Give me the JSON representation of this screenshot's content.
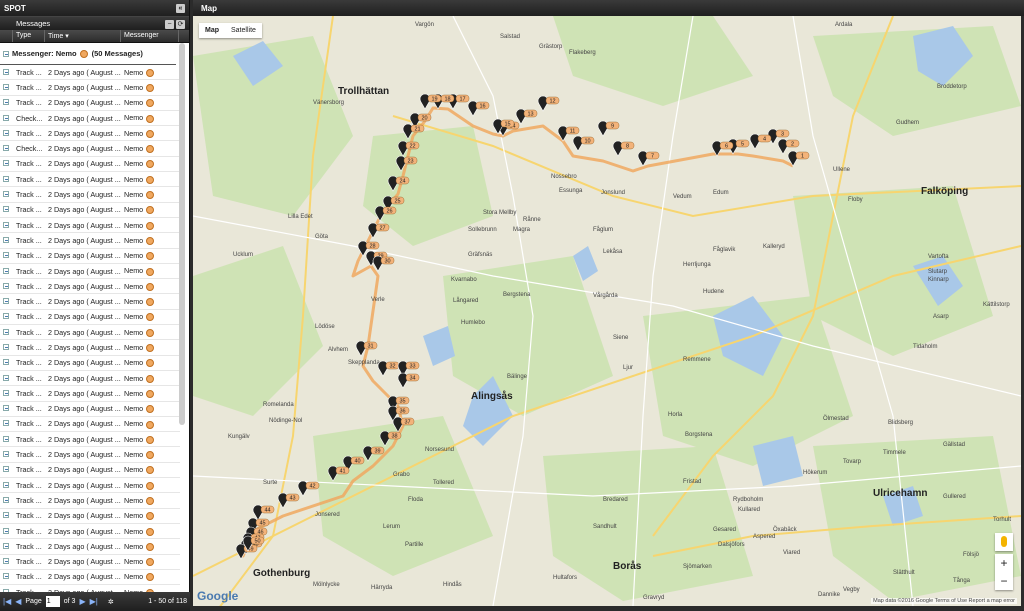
{
  "left_panel": {
    "app_title": "SPOT",
    "messages_title": "Messages",
    "columns": [
      "Type",
      "Time",
      "Messenger"
    ],
    "group_label": "Messenger: Nemo",
    "group_count": "(50 Messages)",
    "rows": [
      {
        "type": "Track ...",
        "time": "2 Days ago ( August ...",
        "messenger": "Nemo"
      },
      {
        "type": "Track ...",
        "time": "2 Days ago ( August ...",
        "messenger": "Nemo"
      },
      {
        "type": "Track ...",
        "time": "2 Days ago ( August ...",
        "messenger": "Nemo"
      },
      {
        "type": "Check...",
        "time": "2 Days ago ( August ...",
        "messenger": "Nemo"
      },
      {
        "type": "Track ...",
        "time": "2 Days ago ( August ...",
        "messenger": "Nemo"
      },
      {
        "type": "Check...",
        "time": "2 Days ago ( August ...",
        "messenger": "Nemo"
      },
      {
        "type": "Track ...",
        "time": "2 Days ago ( August ...",
        "messenger": "Nemo"
      },
      {
        "type": "Track ...",
        "time": "2 Days ago ( August ...",
        "messenger": "Nemo"
      },
      {
        "type": "Track ...",
        "time": "2 Days ago ( August ...",
        "messenger": "Nemo"
      },
      {
        "type": "Track ...",
        "time": "2 Days ago ( August ...",
        "messenger": "Nemo"
      },
      {
        "type": "Track ...",
        "time": "2 Days ago ( August ...",
        "messenger": "Nemo"
      },
      {
        "type": "Track ...",
        "time": "2 Days ago ( August ...",
        "messenger": "Nemo"
      },
      {
        "type": "Track ...",
        "time": "2 Days ago ( August ...",
        "messenger": "Nemo"
      },
      {
        "type": "Track ...",
        "time": "2 Days ago ( August ...",
        "messenger": "Nemo"
      },
      {
        "type": "Track ...",
        "time": "2 Days ago ( August ...",
        "messenger": "Nemo"
      },
      {
        "type": "Track ...",
        "time": "2 Days ago ( August ...",
        "messenger": "Nemo"
      },
      {
        "type": "Track ...",
        "time": "2 Days ago ( August ...",
        "messenger": "Nemo"
      },
      {
        "type": "Track ...",
        "time": "2 Days ago ( August ...",
        "messenger": "Nemo"
      },
      {
        "type": "Track ...",
        "time": "2 Days ago ( August ...",
        "messenger": "Nemo"
      },
      {
        "type": "Track ...",
        "time": "2 Days ago ( August ...",
        "messenger": "Nemo"
      },
      {
        "type": "Track ...",
        "time": "2 Days ago ( August ...",
        "messenger": "Nemo"
      },
      {
        "type": "Track ...",
        "time": "2 Days ago ( August ...",
        "messenger": "Nemo"
      },
      {
        "type": "Track ...",
        "time": "2 Days ago ( August ...",
        "messenger": "Nemo"
      },
      {
        "type": "Track ...",
        "time": "2 Days ago ( August ...",
        "messenger": "Nemo"
      },
      {
        "type": "Track ...",
        "time": "2 Days ago ( August ...",
        "messenger": "Nemo"
      },
      {
        "type": "Track ...",
        "time": "2 Days ago ( August ...",
        "messenger": "Nemo"
      },
      {
        "type": "Track ...",
        "time": "2 Days ago ( August ...",
        "messenger": "Nemo"
      },
      {
        "type": "Track ...",
        "time": "2 Days ago ( August ...",
        "messenger": "Nemo"
      },
      {
        "type": "Track ...",
        "time": "2 Days ago ( August ...",
        "messenger": "Nemo"
      },
      {
        "type": "Track ...",
        "time": "2 Days ago ( August ...",
        "messenger": "Nemo"
      },
      {
        "type": "Track ...",
        "time": "2 Days ago ( August ...",
        "messenger": "Nemo"
      },
      {
        "type": "Track ...",
        "time": "2 Days ago ( August ...",
        "messenger": "Nemo"
      },
      {
        "type": "Track ...",
        "time": "2 Days ago ( August ...",
        "messenger": "Nemo"
      },
      {
        "type": "Track ...",
        "time": "2 Days ago ( August ...",
        "messenger": "Nemo"
      },
      {
        "type": "Track ...",
        "time": "2 Days ago ( August ...",
        "messenger": "Nemo"
      }
    ],
    "footer": {
      "page_label": "Page",
      "page_value": "1",
      "of_label": "of 3",
      "range_label": "1 - 50 of 118"
    }
  },
  "map_panel": {
    "title": "Map",
    "map_types": [
      "Map",
      "Satellite"
    ],
    "attribution": "Map data ©2016 Google   Terms of Use   Report a map error",
    "logo": "Google",
    "towns": [
      "Vargön",
      "Trollhättan",
      "Vänersborg",
      "Grästorp",
      "Flakeberg",
      "Salstad",
      "Ardala",
      "Broddetorp",
      "Gudhem",
      "Falköping",
      "Nossebro",
      "Essunga",
      "Jonslund",
      "Vedum",
      "Edum",
      "Ullene",
      "Floby",
      "Sollebrunn",
      "Stora Mellby",
      "Magra",
      "Fåglum",
      "Lekåsa",
      "Rånne",
      "Herrljunga",
      "Hudene",
      "Fåglavik",
      "Kalleryd",
      "Vårgårda",
      "Bergstena",
      "Långared",
      "Kvarnabo",
      "Gräfsnäs",
      "Lilla Edet",
      "Göta",
      "Ucklum",
      "Lödöse",
      "Alvhem",
      "Skepplanda",
      "Verle",
      "Humlebo",
      "Siene",
      "Ljur",
      "Remmene",
      "Horla",
      "Alingsås",
      "Bälinge",
      "Norsesund",
      "Tollered",
      "Grabo",
      "Floda",
      "Lerum",
      "Partille",
      "Gothenburg",
      "Mölnlycke",
      "Härryda",
      "Hindås",
      "Borås",
      "Hultafors",
      "Sandhult",
      "Bredared",
      "Fristad",
      "Gesared",
      "Öxabäck",
      "Ulricehamn",
      "Gällstad",
      "Gullered",
      "Tovarp",
      "Timmele",
      "Hökerum",
      "Blidsberg",
      "Borgstena",
      "Ölmestad",
      "Vartofta",
      "Slutarp",
      "Kinnarp",
      "Asarp",
      "Tidaholm",
      "Kättilstorp",
      "Torhult",
      "Vegby",
      "Kungälv",
      "Romelanda",
      "Nödinge-Nol",
      "Surte",
      "Jonsered",
      "Kullared",
      "Bollebygd",
      "Aspered",
      "Dalsjöfors",
      "Rydboholm",
      "Sjömarken",
      "Viared",
      "Dannike",
      "Fölsjö",
      "Slätthult",
      "Tånga",
      "Gravryd"
    ],
    "markers": [
      "1",
      "2",
      "3",
      "4",
      "5",
      "6",
      "7",
      "8",
      "9",
      "10",
      "11",
      "12",
      "13",
      "14",
      "15",
      "16",
      "17",
      "18",
      "19",
      "20",
      "21",
      "22",
      "23",
      "24",
      "25",
      "26",
      "27",
      "28",
      "29",
      "30",
      "31",
      "32",
      "33",
      "34",
      "35",
      "36",
      "37",
      "38",
      "39",
      "40",
      "41",
      "42",
      "43",
      "44",
      "45",
      "46",
      "47",
      "48",
      "49",
      "50"
    ],
    "zoom_in": "+",
    "zoom_out": "−"
  },
  "colors": {
    "track": "#f0a860",
    "marker": "#222222",
    "label": "#f3b37a",
    "lake": "#a9c8e8",
    "forest": "#cfe3b5"
  }
}
